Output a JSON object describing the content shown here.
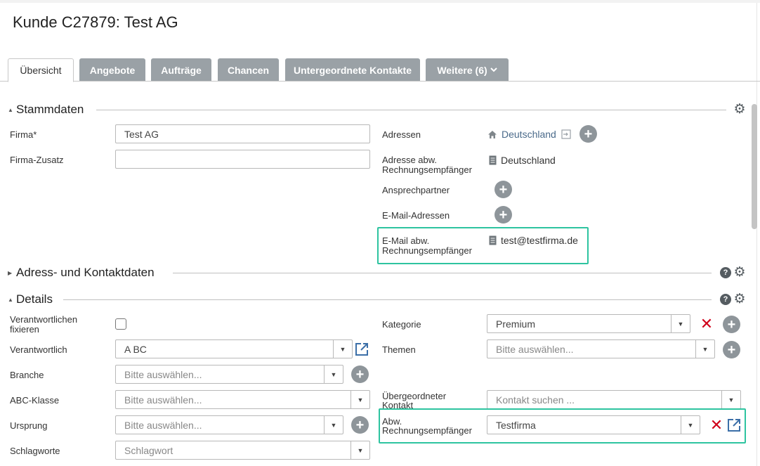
{
  "page": {
    "title": "Kunde C27879: Test AG"
  },
  "tabs": [
    {
      "label": "Übersicht",
      "active": true
    },
    {
      "label": "Angebote"
    },
    {
      "label": "Aufträge"
    },
    {
      "label": "Chancen"
    },
    {
      "label": "Untergeordnete Kontakte"
    },
    {
      "label": "Weitere (6)"
    }
  ],
  "stammdaten": {
    "title": "Stammdaten",
    "firma_label": "Firma*",
    "firma_value": "Test AG",
    "firma_zusatz_label": "Firma-Zusatz",
    "firma_zusatz_value": "",
    "adressen_label": "Adressen",
    "adressen_value": "Deutschland",
    "adresse_abw_label_1": "Adresse abw.",
    "adresse_abw_label_2": "Rechnungsempfänger",
    "adresse_abw_value": "Deutschland",
    "ansprechpartner_label": "Ansprechpartner",
    "email_label": "E-Mail-Adressen",
    "email_abw_label_1": "E-Mail abw.",
    "email_abw_label_2": "Rechnungsempfänger",
    "email_abw_value": "test@testfirma.de"
  },
  "adress": {
    "title": "Adress- und Kontaktdaten"
  },
  "details": {
    "title": "Details",
    "fix_label_1": "Verantwortlichen",
    "fix_label_2": "fixieren",
    "fix_checked": false,
    "verantwortlich_label": "Verantwortlich",
    "verantwortlich_value": "A BC",
    "branche_label": "Branche",
    "branche_placeholder": "Bitte auswählen...",
    "abc_label": "ABC-Klasse",
    "abc_placeholder": "Bitte auswählen...",
    "ursprung_label": "Ursprung",
    "ursprung_placeholder": "Bitte auswählen...",
    "schlagworte_label": "Schlagworte",
    "schlagworte_placeholder": "Schlagwort",
    "kategorie_label": "Kategorie",
    "kategorie_value": "Premium",
    "themen_label": "Themen",
    "themen_placeholder": "Bitte auswählen...",
    "uebergeordnet_label_1": "Übergeordneter",
    "uebergeordnet_label_2": "Kontakt",
    "uebergeordnet_placeholder": "Kontakt suchen ...",
    "abw_label_1": "Abw.",
    "abw_label_2": "Rechnungsempfänger",
    "abw_value": "Testfirma"
  },
  "icons": {
    "plus": "+",
    "remove": "✕",
    "dropdown": "▼",
    "gear": "⚙",
    "help": "?",
    "expanded": "▲",
    "collapsed": "▶",
    "home": "home-icon",
    "document": "document-icon",
    "edit-address": "edit-address-icon",
    "external-link": "external-link-icon"
  },
  "colors": {
    "tab_bg": "#9aa1a6",
    "plus_bg": "#8e959a",
    "link": "#4a6a8a",
    "remove": "#d0021b",
    "external_link": "#3c6fa8",
    "highlight": "#2ec4a0"
  }
}
